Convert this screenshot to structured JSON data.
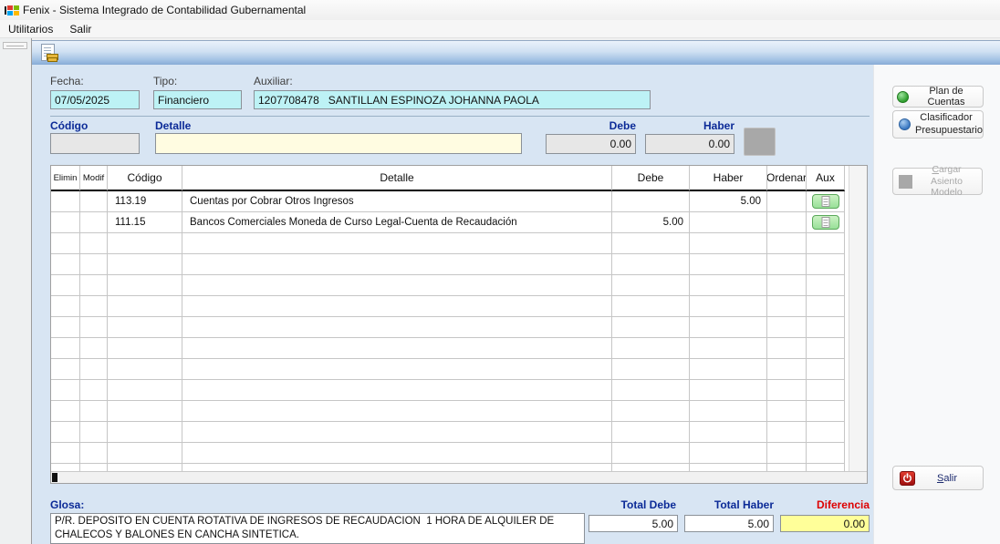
{
  "window": {
    "title": "Fenix - Sistema Integrado de Contabilidad Gubernamental"
  },
  "menu": {
    "items": [
      "Utilitarios",
      "Salir"
    ]
  },
  "form": {
    "fecha": {
      "label": "Fecha:",
      "value": "07/05/2025"
    },
    "tipo": {
      "label": "Tipo:",
      "value": "Financiero"
    },
    "auxiliar": {
      "label": "Auxiliar:",
      "value": "1207708478   SANTILLAN ESPINOZA JOHANNA PAOLA"
    }
  },
  "entry": {
    "codigo": {
      "label": "Código",
      "value": ""
    },
    "detalle": {
      "label": "Detalle",
      "value": ""
    },
    "debe": {
      "label": "Debe",
      "value": "0.00"
    },
    "haber": {
      "label": "Haber",
      "value": "0.00"
    }
  },
  "table": {
    "columns": [
      "Elimin",
      "Modif",
      "Código",
      "Detalle",
      "Debe",
      "Haber",
      "Ordenar",
      "Aux"
    ],
    "rows": [
      {
        "elimin": "",
        "modif": "",
        "codigo": "113.19",
        "detalle": "Cuentas por Cobrar Otros Ingresos",
        "debe": "",
        "haber": "5.00",
        "ordenar": "",
        "aux": "aux-detail-button"
      },
      {
        "elimin": "",
        "modif": "",
        "codigo": "111.15",
        "detalle": "Bancos Comerciales Moneda de Curso Legal-Cuenta de Recaudación",
        "debe": "5.00",
        "haber": "",
        "ordenar": "",
        "aux": "aux-detail-button"
      }
    ]
  },
  "actions": {
    "plan_de_cuentas": "Plan de Cuentas",
    "clasificador_presupuestario": "Clasificador Presupuestario",
    "cargar_asiento_modelo": "Cargar Asiento Modelo",
    "salir": "Salir"
  },
  "footer": {
    "glosa_label": "Glosa:",
    "glosa_value": "P/R. DEPOSITO EN CUENTA ROTATIVA DE INGRESOS DE RECAUDACION  1 HORA DE ALQUILER DE CHALECOS Y BALONES EN CANCHA SINTETICA.",
    "total_debe": {
      "label": "Total Debe",
      "value": "5.00"
    },
    "total_haber": {
      "label": "Total Haber",
      "value": "5.00"
    },
    "diferencia": {
      "label": "Diferencia",
      "value": "0.00"
    }
  },
  "colors": {
    "field_cyan": "#bdf2f5",
    "field_yellow": "#fffce1",
    "diferencia_yellow": "#ffff99",
    "label_blue": "#0b2a97",
    "diferencia_red": "#dd0000",
    "aux_green": "#98e098",
    "toolbar_blue": "#87abd6",
    "panel_blue": "#d8e5f3"
  }
}
